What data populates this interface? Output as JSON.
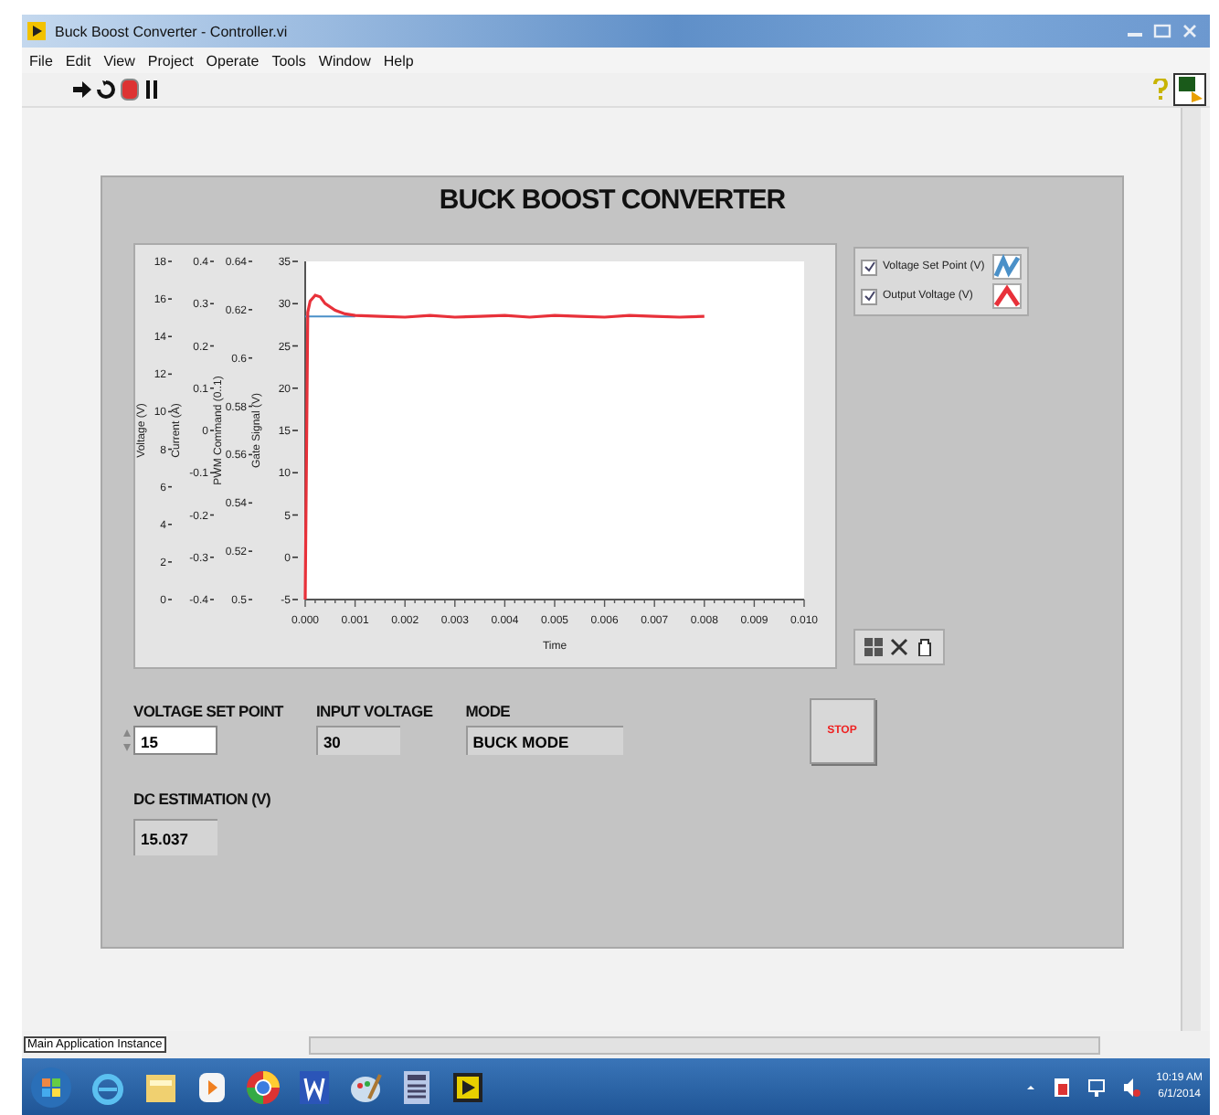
{
  "window": {
    "title": "Buck Boost Converter - Controller.vi"
  },
  "menu": [
    "File",
    "Edit",
    "View",
    "Project",
    "Operate",
    "Tools",
    "Window",
    "Help"
  ],
  "panel": {
    "title": "BUCK BOOST CONVERTER",
    "graph": {
      "secondary_axes": [
        {
          "label": "Voltage (V)",
          "ticks": [
            "18",
            "16",
            "14",
            "12",
            "10",
            "8",
            "6",
            "4",
            "2",
            "0"
          ]
        },
        {
          "label": "Current (A)",
          "ticks": [
            "0.4",
            "0.3",
            "0.2",
            "0.1",
            "0",
            "-0.1",
            "-0.2",
            "-0.3",
            "-0.4"
          ]
        },
        {
          "label": "PWM Command (0..1)",
          "ticks": [
            "0.64",
            "0.62",
            "0.6",
            "0.58",
            "0.56",
            "0.54",
            "0.52",
            "0.5"
          ]
        }
      ],
      "chart_data": {
        "type": "line",
        "xlabel": "Time",
        "ylabel": "Gate Signal (V)",
        "xlim": [
          0,
          0.01
        ],
        "ylim": [
          -5,
          35
        ],
        "xticks": [
          {
            "value": 0,
            "label": "0.000"
          },
          {
            "value": 0.001,
            "label": "0.001"
          },
          {
            "value": 0.002,
            "label": "0.002"
          },
          {
            "value": 0.003,
            "label": "0.003"
          },
          {
            "value": 0.004,
            "label": "0.004"
          },
          {
            "value": 0.005,
            "label": "0.005"
          },
          {
            "value": 0.006,
            "label": "0.006"
          },
          {
            "value": 0.007,
            "label": "0.007"
          },
          {
            "value": 0.008,
            "label": "0.008"
          },
          {
            "value": 0.009,
            "label": "0.009"
          },
          {
            "value": 0.01,
            "label": "0.010"
          }
        ],
        "yticks": [
          -5,
          0,
          5,
          10,
          15,
          20,
          25,
          30,
          35
        ],
        "x": [
          0,
          5e-05,
          0.0001,
          0.0002,
          0.0003,
          0.0004,
          0.0006,
          0.0008,
          0.001,
          0.0015,
          0.002,
          0.0025,
          0.003,
          0.0035,
          0.004,
          0.0045,
          0.005,
          0.0055,
          0.006,
          0.0065,
          0.007,
          0.0075,
          0.008
        ],
        "series": [
          {
            "name": "Voltage Set Point (V)",
            "color": "#4a90c8",
            "values": [
              28.5,
              28.5,
              28.5,
              28.5,
              28.5,
              28.5,
              28.5,
              28.5,
              28.5,
              null,
              null,
              null,
              null,
              null,
              null,
              null,
              null,
              null,
              null,
              null,
              null,
              null,
              null
            ]
          },
          {
            "name": "Output Voltage (V)",
            "color": "#e8313a",
            "values": [
              -5,
              29,
              30.3,
              31,
              30.8,
              30,
              29.2,
              28.8,
              28.6,
              28.5,
              28.4,
              28.6,
              28.4,
              28.5,
              28.6,
              28.4,
              28.6,
              28.5,
              28.4,
              28.6,
              28.5,
              28.4,
              28.5
            ]
          }
        ]
      },
      "legend": [
        {
          "checked": true
        },
        {
          "checked": true
        }
      ]
    },
    "fields": [
      {
        "label": "VOLTAGE SET POINT",
        "value": "15",
        "kind": "control"
      },
      {
        "label": "INPUT VOLTAGE",
        "value": "30",
        "kind": "indicator"
      },
      {
        "label": "MODE",
        "value": "BUCK MODE",
        "kind": "wide"
      }
    ],
    "stop_button": "STOP",
    "dc_estimation": {
      "label": "DC ESTIMATION (V)",
      "value": "15.037"
    }
  },
  "status_bar": {
    "context": "Main Application Instance"
  },
  "taskbar": {
    "time": "10:19 AM",
    "date": "6/1/2014"
  }
}
